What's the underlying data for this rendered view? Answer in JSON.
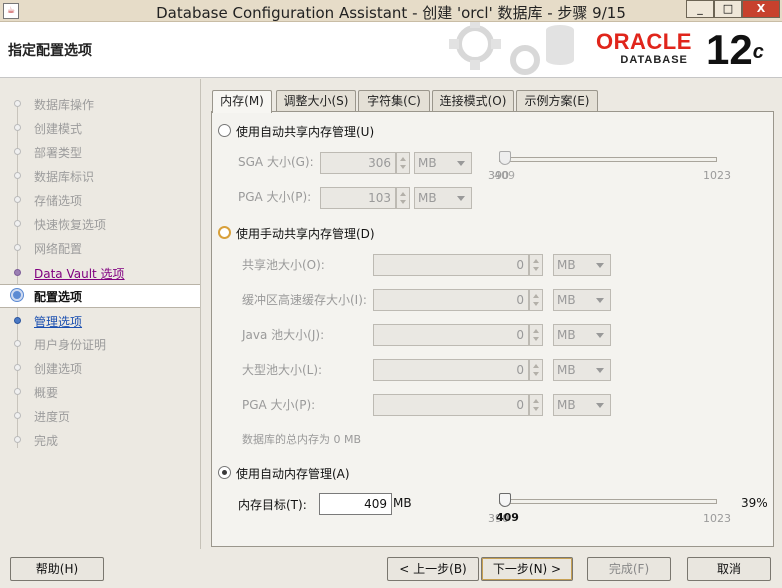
{
  "window": {
    "title": "Database Configuration Assistant - 创建 'orcl' 数据库 - 步骤 9/15",
    "minimize": "_",
    "maximize": "□",
    "close": "X"
  },
  "header": {
    "page_title": "指定配置选项",
    "logo_brand": "ORACLE",
    "logo_product": "DATABASE",
    "version": "12",
    "version_suffix": "c"
  },
  "steps": [
    {
      "label": "数据库操作",
      "state": "disabled"
    },
    {
      "label": "创建模式",
      "state": "disabled"
    },
    {
      "label": "部署类型",
      "state": "disabled"
    },
    {
      "label": "数据库标识",
      "state": "disabled"
    },
    {
      "label": "存储选项",
      "state": "disabled"
    },
    {
      "label": "快速恢复选项",
      "state": "disabled"
    },
    {
      "label": "网络配置",
      "state": "disabled"
    },
    {
      "label": "Data Vault 选项",
      "state": "visited"
    },
    {
      "label": "配置选项",
      "state": "current"
    },
    {
      "label": "管理选项",
      "state": "link"
    },
    {
      "label": "用户身份证明",
      "state": "disabled"
    },
    {
      "label": "创建选项",
      "state": "disabled"
    },
    {
      "label": "概要",
      "state": "disabled"
    },
    {
      "label": "进度页",
      "state": "disabled"
    },
    {
      "label": "完成",
      "state": "disabled"
    }
  ],
  "tabs": [
    {
      "label": "内存(M)",
      "active": true
    },
    {
      "label": "调整大小(S)",
      "active": false
    },
    {
      "label": "字符集(C)",
      "active": false
    },
    {
      "label": "连接模式(O)",
      "active": false
    },
    {
      "label": "示例方案(E)",
      "active": false
    }
  ],
  "memory": {
    "auto_shared": {
      "label": "使用自动共享内存管理(U)",
      "sga_label": "SGA 大小(G):",
      "sga_value": "306",
      "sga_unit": "MB",
      "pga_label": "PGA 大小(P):",
      "pga_value": "103",
      "pga_unit": "MB",
      "slider_min": "390",
      "slider_min_overlap": "409",
      "slider_max": "1023"
    },
    "manual_shared": {
      "label": "使用手动共享内存管理(D)",
      "fields": [
        {
          "label": "共享池大小(O):",
          "value": "0",
          "unit": "MB"
        },
        {
          "label": "缓冲区高速缓存大小(I):",
          "value": "0",
          "unit": "MB"
        },
        {
          "label": "Java 池大小(J):",
          "value": "0",
          "unit": "MB"
        },
        {
          "label": "大型池大小(L):",
          "value": "0",
          "unit": "MB"
        },
        {
          "label": "PGA 大小(P):",
          "value": "0",
          "unit": "MB"
        }
      ],
      "total_note": "数据库的总内存为 0 MB"
    },
    "auto_memory": {
      "label": "使用自动内存管理(A)",
      "target_label": "内存目标(T):",
      "target_value": "409",
      "target_unit": "MB",
      "slider_value_label": "409",
      "slider_min": "390",
      "slider_max": "1023",
      "percent": "39%"
    },
    "selected": "auto_memory"
  },
  "buttons": {
    "help": "帮助(H)",
    "back": "< 上一步(B)",
    "next": "下一步(N) >",
    "finish": "完成(F)",
    "cancel": "取消"
  },
  "colors": {
    "oracle_red": "#e0251b",
    "link_blue": "#1a4fb0",
    "visited_purple": "#800080"
  }
}
